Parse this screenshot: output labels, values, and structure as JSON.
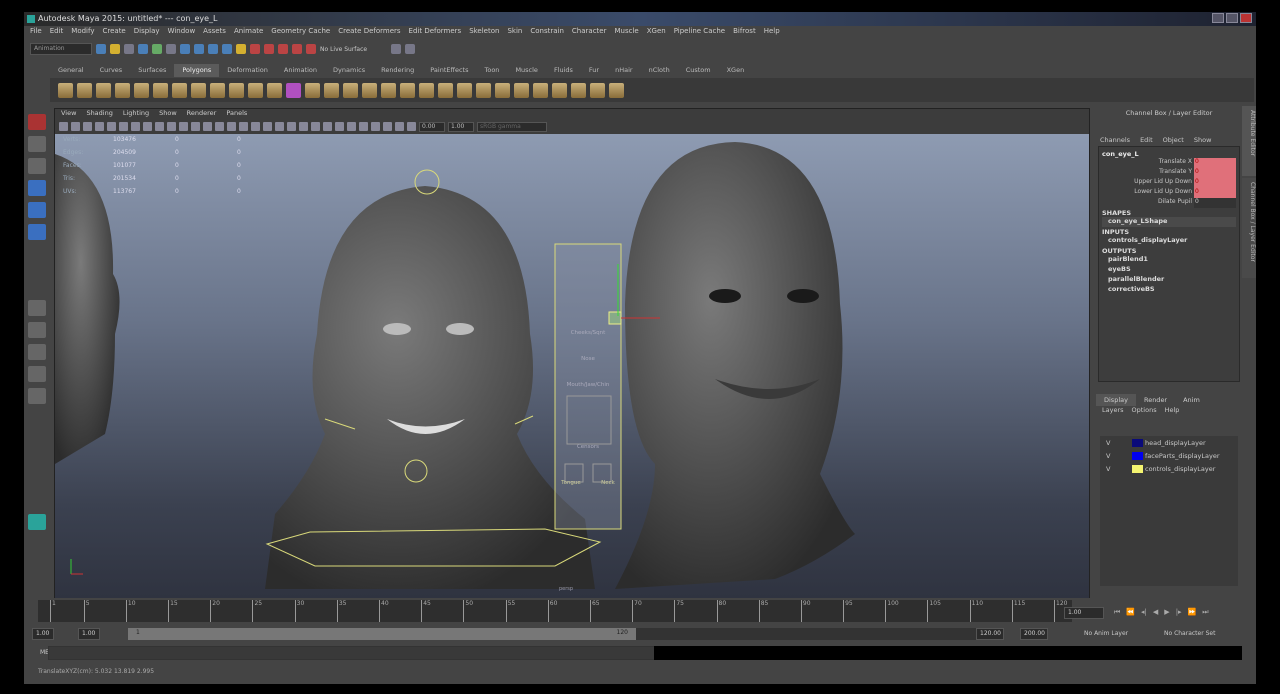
{
  "title": "Autodesk Maya 2015: untitled*   ---   con_eye_L",
  "menu": [
    "File",
    "Edit",
    "Modify",
    "Create",
    "Display",
    "Window",
    "Assets",
    "Animate",
    "Geometry Cache",
    "Create Deformers",
    "Edit Deformers",
    "Skeleton",
    "Skin",
    "Constrain",
    "Character",
    "Muscle",
    "XGen",
    "Pipeline Cache",
    "Bifrost",
    "Help"
  ],
  "status": {
    "mode": "Animation",
    "live_surface": "No Live Surface"
  },
  "shelf_tabs": [
    "General",
    "Curves",
    "Surfaces",
    "Polygons",
    "Deformation",
    "Animation",
    "Dynamics",
    "Rendering",
    "PaintEffects",
    "Toon",
    "Muscle",
    "Fluids",
    "Fur",
    "nHair",
    "nCloth",
    "Custom",
    "XGen"
  ],
  "panel": {
    "menu": [
      "View",
      "Shading",
      "Lighting",
      "Show",
      "Renderer",
      "Panels"
    ],
    "exposure": "0.00",
    "gamma": "1.00",
    "color_space": "sRGB gamma"
  },
  "hud": [
    {
      "label": "Verts:",
      "a": "103476",
      "b": "0",
      "c": "0"
    },
    {
      "label": "Edges:",
      "a": "204509",
      "b": "0",
      "c": "0"
    },
    {
      "label": "Faces:",
      "a": "101077",
      "b": "0",
      "c": "0"
    },
    {
      "label": "Tris:",
      "a": "201534",
      "b": "0",
      "c": "0"
    },
    {
      "label": "UVs:",
      "a": "113767",
      "b": "0",
      "c": "0"
    }
  ],
  "rig_panel": {
    "labels": [
      "Cheeks/Sqnt",
      "Nose",
      "Mouth/Jaw/Chin",
      "Censors",
      "Tongue",
      "Neck"
    ],
    "camera": "persp"
  },
  "channel_box": {
    "header": "Channel Box / Layer Editor",
    "menu": [
      "Channels",
      "Edit",
      "Object",
      "Show"
    ],
    "object": "con_eye_L",
    "attrs": [
      {
        "name": "Translate X",
        "value": "0",
        "keyed": true
      },
      {
        "name": "Translate Y",
        "value": "0",
        "keyed": true
      },
      {
        "name": "Upper Lid Up Down",
        "value": "0",
        "keyed": true
      },
      {
        "name": "Lower Lid Up Down",
        "value": "0",
        "keyed": true
      },
      {
        "name": "Dilate Pupil",
        "value": "0",
        "keyed": false
      }
    ],
    "shapes_label": "SHAPES",
    "shapes": [
      "con_eye_LShape"
    ],
    "inputs_label": "INPUTS",
    "inputs": [
      "controls_displayLayer"
    ],
    "outputs_label": "OUTPUTS",
    "outputs": [
      "pairBlend1",
      "eyeBS",
      "parallelBlender",
      "correctiveBS"
    ]
  },
  "side_tabs": [
    "Attribute Editor",
    "Channel Box / Layer Editor"
  ],
  "layer_editor": {
    "tabs": [
      "Display",
      "Render",
      "Anim"
    ],
    "menu": [
      "Layers",
      "Options",
      "Help"
    ],
    "layers": [
      {
        "v": "V",
        "name": "head_displayLayer",
        "color": "#0a0a7a"
      },
      {
        "v": "V",
        "name": "faceParts_displayLayer",
        "color": "#0000f0"
      },
      {
        "v": "V",
        "name": "controls_displayLayer",
        "color": "#f4f470"
      }
    ]
  },
  "timeline": {
    "ticks": [
      "1",
      "5",
      "10",
      "15",
      "20",
      "25",
      "30",
      "35",
      "40",
      "45",
      "50",
      "55",
      "60",
      "65",
      "70",
      "75",
      "80",
      "85",
      "90",
      "95",
      "100",
      "105",
      "110",
      "115",
      "120"
    ],
    "current": "1.00"
  },
  "range": {
    "start": "1.00",
    "start2": "1.00",
    "slider_start": "1",
    "slider_end": "120",
    "end": "120.00",
    "end2": "200.00",
    "anim_layer": "No Anim Layer",
    "char_set": "No Character Set"
  },
  "cmd_label": "MEL",
  "help_line": "TranslateXYZ(cm):   5.032    13.819    2.995"
}
